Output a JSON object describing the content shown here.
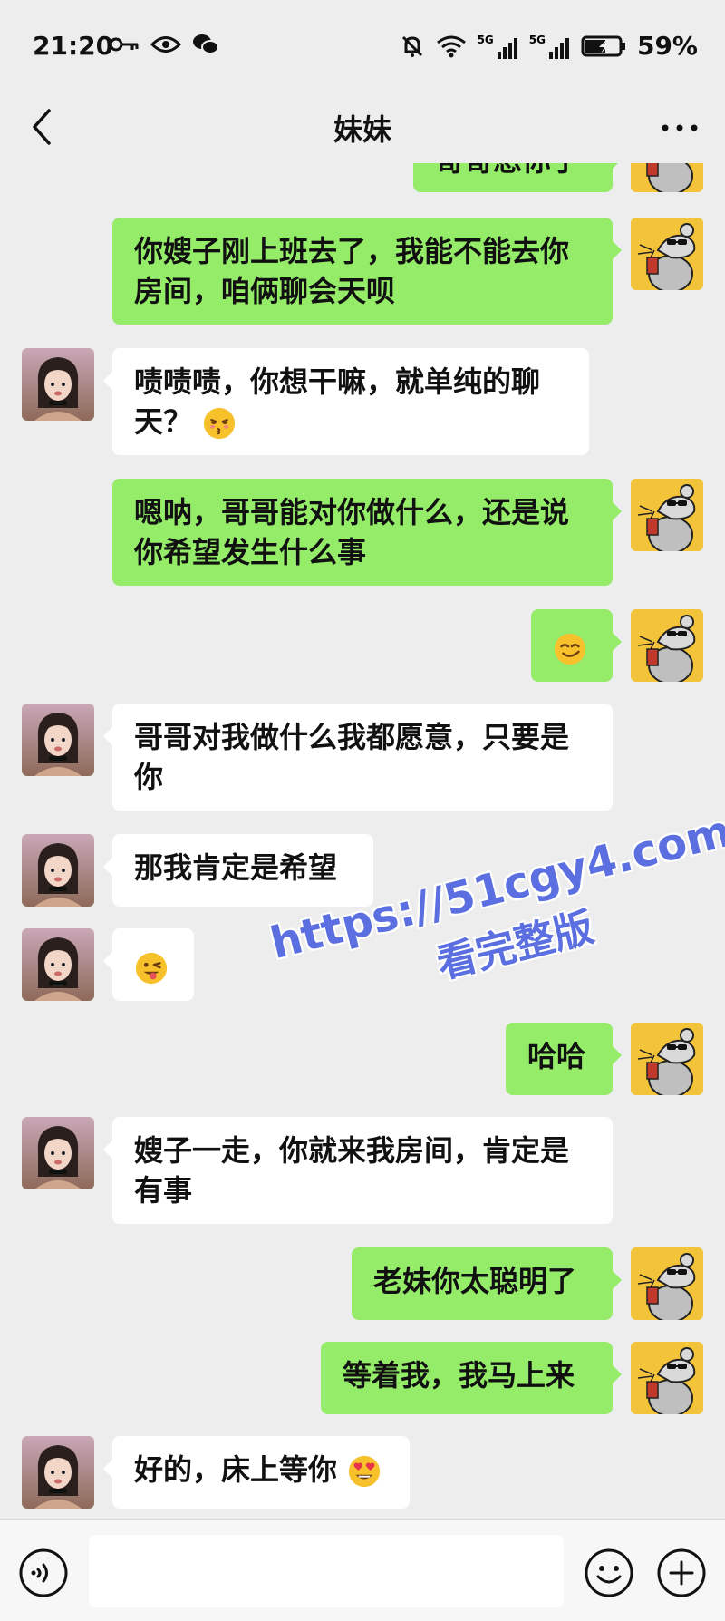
{
  "status_bar": {
    "time": "21:20",
    "battery_percent": "59%",
    "network_1": "5G",
    "network_2": "5G"
  },
  "header": {
    "title": "妹妹",
    "back_icon": "chevron-left-icon",
    "more_icon": "more-dots-icon"
  },
  "messages": [
    {
      "side": "out",
      "text": "哥哥想你了"
    },
    {
      "side": "out",
      "text": "你嫂子刚上班去了，我能不能去你房间，咱俩聊会天呗"
    },
    {
      "side": "in",
      "text": "啧啧啧，你想干嘛，就单纯的聊天？",
      "emoji": "kissing-face-icon"
    },
    {
      "side": "out",
      "text": "嗯呐，哥哥能对你做什么，还是说你希望发生什么事"
    },
    {
      "side": "out",
      "text": "",
      "emoji": "smirk-face-icon"
    },
    {
      "side": "in",
      "text": "哥哥对我做什么我都愿意，只要是你"
    },
    {
      "side": "in",
      "text": "那我肯定是希望"
    },
    {
      "side": "in",
      "text": "",
      "emoji": "wink-tongue-face-icon"
    },
    {
      "side": "out",
      "text": "哈哈"
    },
    {
      "side": "in",
      "text": "嫂子一走，你就来我房间，肯定是有事"
    },
    {
      "side": "out",
      "text": "老妹你太聪明了"
    },
    {
      "side": "out",
      "text": "等着我，我马上来"
    },
    {
      "side": "in",
      "text": "好的，床上等你",
      "emoji": "heart-eyes-face-icon"
    }
  ],
  "watermark": {
    "url": "https://51cgy4.com",
    "sub": "看完整版"
  },
  "input_bar": {
    "voice_icon": "voice-icon",
    "emoji_icon": "smile-icon",
    "plus_icon": "plus-icon",
    "value": ""
  },
  "colors": {
    "background": "#ededed",
    "outgoing_bubble": "#95ec69",
    "incoming_bubble": "#ffffff",
    "watermark": "#5b6fe0"
  }
}
